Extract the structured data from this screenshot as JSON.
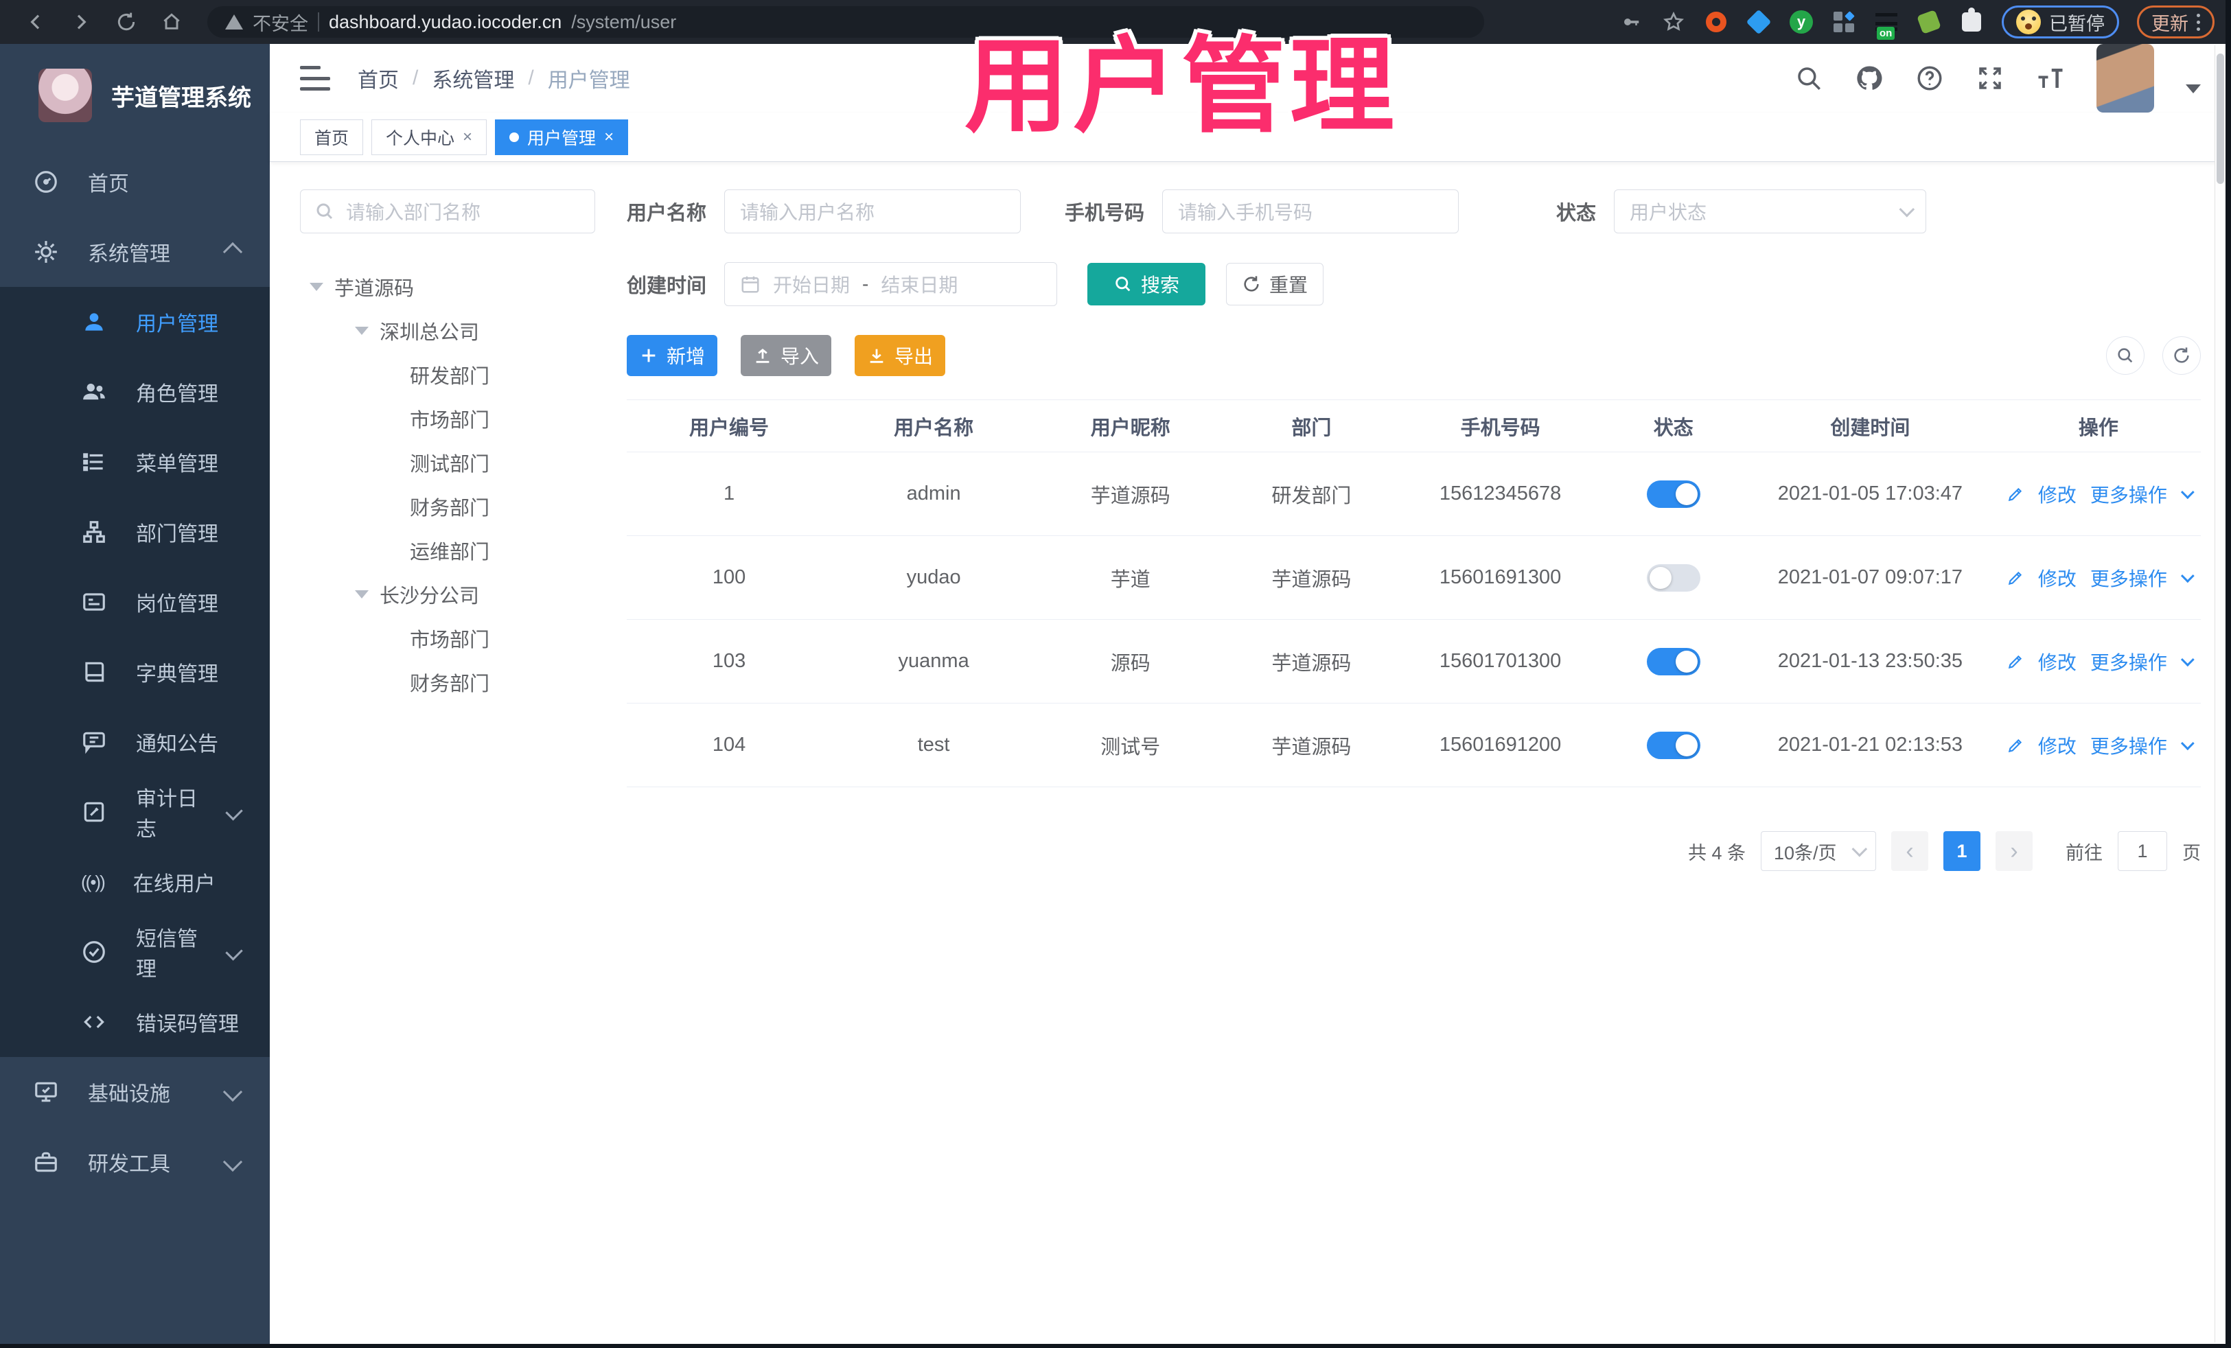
{
  "browser": {
    "security_label": "不安全",
    "url_host": "dashboard.yudao.iocoder.cn",
    "url_path": "/system/user",
    "paused_badge": "已暂停",
    "update_button": "更新"
  },
  "overlay": {
    "title": "用户管理"
  },
  "sidebar": {
    "logo_title": "芋道管理系统",
    "items": [
      {
        "label": "首页"
      },
      {
        "label": "系统管理",
        "expanded": true
      },
      {
        "label": "用户管理",
        "active": true
      },
      {
        "label": "角色管理"
      },
      {
        "label": "菜单管理"
      },
      {
        "label": "部门管理"
      },
      {
        "label": "岗位管理"
      },
      {
        "label": "字典管理"
      },
      {
        "label": "通知公告"
      },
      {
        "label": "审计日志"
      },
      {
        "label": "在线用户"
      },
      {
        "label": "短信管理"
      },
      {
        "label": "错误码管理"
      },
      {
        "label": "基础设施"
      },
      {
        "label": "研发工具"
      }
    ]
  },
  "header": {
    "breadcrumb": {
      "home": "首页",
      "section": "系统管理",
      "current": "用户管理",
      "separator": "/"
    },
    "tabs": [
      {
        "label": "首页",
        "closable": false,
        "active": false
      },
      {
        "label": "个人中心",
        "closable": true,
        "active": false
      },
      {
        "label": "用户管理",
        "closable": true,
        "active": true
      }
    ],
    "close_symbol": "×"
  },
  "dept_panel": {
    "search_placeholder": "请输入部门名称",
    "tree": [
      {
        "label": "芋道源码",
        "level": 0,
        "expanded": true
      },
      {
        "label": "深圳总公司",
        "level": 1,
        "expanded": true
      },
      {
        "label": "研发部门",
        "level": 2
      },
      {
        "label": "市场部门",
        "level": 2
      },
      {
        "label": "测试部门",
        "level": 2
      },
      {
        "label": "财务部门",
        "level": 2
      },
      {
        "label": "运维部门",
        "level": 2
      },
      {
        "label": "长沙分公司",
        "level": 1,
        "expanded": true
      },
      {
        "label": "市场部门",
        "level": 2
      },
      {
        "label": "财务部门",
        "level": 2
      }
    ]
  },
  "filters": {
    "username_label": "用户名称",
    "username_placeholder": "请输入用户名称",
    "mobile_label": "手机号码",
    "mobile_placeholder": "请输入手机号码",
    "status_label": "状态",
    "status_placeholder": "用户状态",
    "create_time_label": "创建时间",
    "date_start_placeholder": "开始日期",
    "date_separator": "-",
    "date_end_placeholder": "结束日期",
    "search_button": "搜索",
    "reset_button": "重置"
  },
  "toolbar": {
    "add": "新增",
    "import": "导入",
    "export": "导出"
  },
  "table": {
    "columns": [
      "用户编号",
      "用户名称",
      "用户昵称",
      "部门",
      "手机号码",
      "状态",
      "创建时间",
      "操作"
    ],
    "rows": [
      {
        "id": "1",
        "username": "admin",
        "nickname": "芋道源码",
        "dept": "研发部门",
        "mobile": "15612345678",
        "status": true,
        "create_time": "2021-01-05 17:03:47"
      },
      {
        "id": "100",
        "username": "yudao",
        "nickname": "芋道",
        "dept": "芋道源码",
        "mobile": "15601691300",
        "status": false,
        "create_time": "2021-01-07 09:07:17"
      },
      {
        "id": "103",
        "username": "yuanma",
        "nickname": "源码",
        "dept": "芋道源码",
        "mobile": "15601701300",
        "status": true,
        "create_time": "2021-01-13 23:50:35"
      },
      {
        "id": "104",
        "username": "test",
        "nickname": "测试号",
        "dept": "芋道源码",
        "mobile": "15601691200",
        "status": true,
        "create_time": "2021-01-21 02:13:53"
      }
    ],
    "actions": {
      "edit": "修改",
      "more": "更多操作"
    }
  },
  "pagination": {
    "total_text": "共 4 条",
    "page_size": "10条/页",
    "current_page": "1",
    "goto_label": "前往",
    "goto_value": "1",
    "page_label": "页"
  },
  "colors": {
    "accent_blue": "#2d8cf0",
    "sidebar_bg": "#304156",
    "submenu_bg": "#1f2d3d",
    "search_button": "#15a89c",
    "export_button": "#f0a020",
    "overlay_pink": "#fb2d6d"
  }
}
